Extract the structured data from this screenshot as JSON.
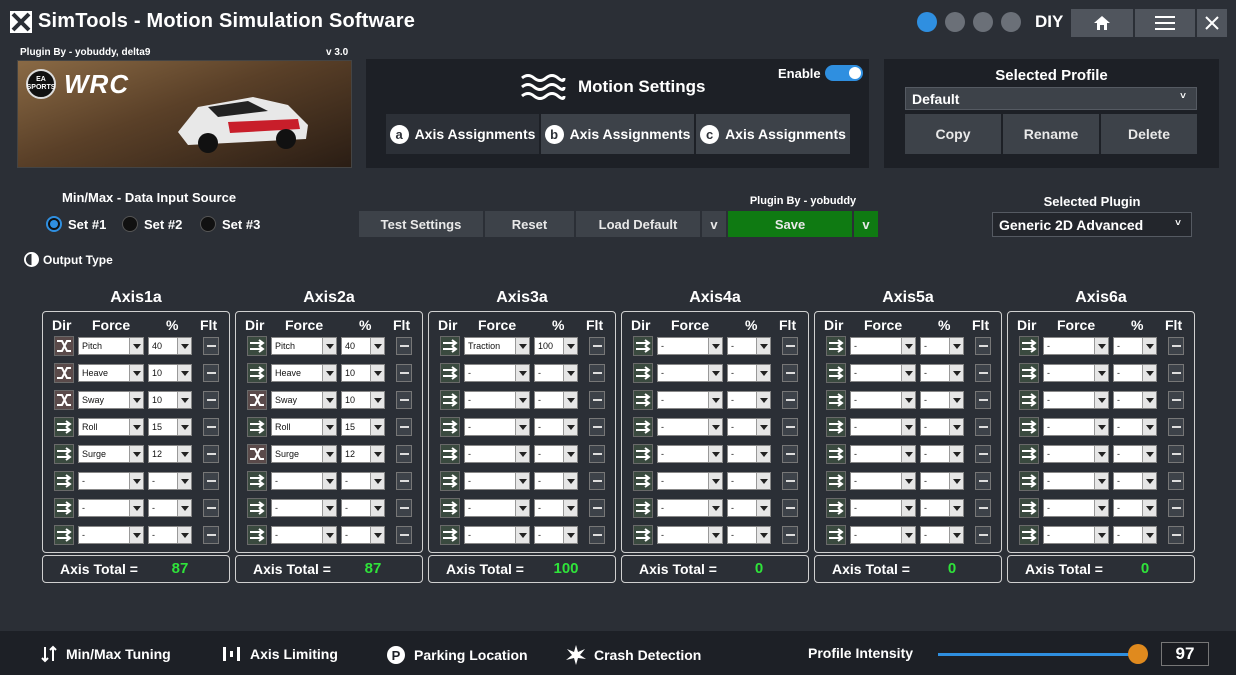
{
  "window": {
    "title": "SimTools - Motion Simulation Software",
    "mode": "DIY",
    "icons": [
      "upload-icon",
      "sun-icon",
      "pencil-icon",
      "hand-icon"
    ]
  },
  "plugin_panel": {
    "credit": "Plugin By - yobuddy, delta9",
    "version": "v 3.0",
    "ea_label": "EA SPORTS",
    "game_logo": "WRC"
  },
  "motion_settings": {
    "title": "Motion Settings",
    "enable_label": "Enable",
    "enabled": true,
    "tabs": [
      {
        "letter": "a",
        "label": "Axis Assignments"
      },
      {
        "letter": "b",
        "label": "Axis Assignments"
      },
      {
        "letter": "c",
        "label": "Axis Assignments"
      }
    ]
  },
  "profile": {
    "title": "Selected Profile",
    "value": "Default",
    "copy": "Copy",
    "rename": "Rename",
    "delete": "Delete"
  },
  "data_source": {
    "title": "Min/Max - Data Input Source",
    "options": [
      "Set #1",
      "Set #2",
      "Set #3"
    ],
    "selected": 0
  },
  "output_type_label": "Output Type",
  "toolbar": {
    "test": "Test Settings",
    "reset": "Reset",
    "load_default": "Load Default",
    "dropdown": "v",
    "save_credit": "Plugin By - yobuddy",
    "save": "Save",
    "save_dropdown": "v"
  },
  "selected_plugin": {
    "title": "Selected Plugin",
    "value": "Generic 2D Advanced"
  },
  "column_headers": {
    "dir": "Dir",
    "force": "Force",
    "pct": "%",
    "flt": "Flt"
  },
  "total_label": "Axis Total =",
  "axes": [
    {
      "name": "Axis1a",
      "total": "87",
      "rows": [
        {
          "force": "Pitch",
          "pct": "40",
          "inv": true
        },
        {
          "force": "Heave",
          "pct": "10",
          "inv": true
        },
        {
          "force": "Sway",
          "pct": "10",
          "inv": true
        },
        {
          "force": "Roll",
          "pct": "15",
          "inv": false
        },
        {
          "force": "Surge",
          "pct": "12",
          "inv": false
        },
        {
          "force": "-",
          "pct": "-",
          "inv": false
        },
        {
          "force": "-",
          "pct": "-",
          "inv": false
        },
        {
          "force": "-",
          "pct": "-",
          "inv": false
        }
      ]
    },
    {
      "name": "Axis2a",
      "total": "87",
      "rows": [
        {
          "force": "Pitch",
          "pct": "40",
          "inv": false
        },
        {
          "force": "Heave",
          "pct": "10",
          "inv": false
        },
        {
          "force": "Sway",
          "pct": "10",
          "inv": true
        },
        {
          "force": "Roll",
          "pct": "15",
          "inv": false
        },
        {
          "force": "Surge",
          "pct": "12",
          "inv": true
        },
        {
          "force": "-",
          "pct": "-",
          "inv": false
        },
        {
          "force": "-",
          "pct": "-",
          "inv": false
        },
        {
          "force": "-",
          "pct": "-",
          "inv": false
        }
      ]
    },
    {
      "name": "Axis3a",
      "total": "100",
      "rows": [
        {
          "force": "Traction",
          "pct": "100",
          "inv": false
        },
        {
          "force": "-",
          "pct": "-",
          "inv": false
        },
        {
          "force": "-",
          "pct": "-",
          "inv": false
        },
        {
          "force": "-",
          "pct": "-",
          "inv": false
        },
        {
          "force": "-",
          "pct": "-",
          "inv": false
        },
        {
          "force": "-",
          "pct": "-",
          "inv": false
        },
        {
          "force": "-",
          "pct": "-",
          "inv": false
        },
        {
          "force": "-",
          "pct": "-",
          "inv": false
        }
      ]
    },
    {
      "name": "Axis4a",
      "total": "0",
      "rows": [
        {
          "force": "-",
          "pct": "-",
          "inv": false
        },
        {
          "force": "-",
          "pct": "-",
          "inv": false
        },
        {
          "force": "-",
          "pct": "-",
          "inv": false
        },
        {
          "force": "-",
          "pct": "-",
          "inv": false
        },
        {
          "force": "-",
          "pct": "-",
          "inv": false
        },
        {
          "force": "-",
          "pct": "-",
          "inv": false
        },
        {
          "force": "-",
          "pct": "-",
          "inv": false
        },
        {
          "force": "-",
          "pct": "-",
          "inv": false
        }
      ]
    },
    {
      "name": "Axis5a",
      "total": "0",
      "rows": [
        {
          "force": "-",
          "pct": "-",
          "inv": false
        },
        {
          "force": "-",
          "pct": "-",
          "inv": false
        },
        {
          "force": "-",
          "pct": "-",
          "inv": false
        },
        {
          "force": "-",
          "pct": "-",
          "inv": false
        },
        {
          "force": "-",
          "pct": "-",
          "inv": false
        },
        {
          "force": "-",
          "pct": "-",
          "inv": false
        },
        {
          "force": "-",
          "pct": "-",
          "inv": false
        },
        {
          "force": "-",
          "pct": "-",
          "inv": false
        }
      ]
    },
    {
      "name": "Axis6a",
      "total": "0",
      "rows": [
        {
          "force": "-",
          "pct": "-",
          "inv": false
        },
        {
          "force": "-",
          "pct": "-",
          "inv": false
        },
        {
          "force": "-",
          "pct": "-",
          "inv": false
        },
        {
          "force": "-",
          "pct": "-",
          "inv": false
        },
        {
          "force": "-",
          "pct": "-",
          "inv": false
        },
        {
          "force": "-",
          "pct": "-",
          "inv": false
        },
        {
          "force": "-",
          "pct": "-",
          "inv": false
        },
        {
          "force": "-",
          "pct": "-",
          "inv": false
        }
      ]
    }
  ],
  "bottom": {
    "items": [
      "Min/Max Tuning",
      "Axis Limiting",
      "Parking Location",
      "Crash Detection"
    ],
    "intensity_label": "Profile Intensity",
    "intensity_value": "97",
    "intensity_fraction": 0.97
  },
  "colors": {
    "accent": "#2f8fe0",
    "save_green": "#0f7a12",
    "total_green": "#2fe33a",
    "slider_knob": "#e08a1e"
  }
}
